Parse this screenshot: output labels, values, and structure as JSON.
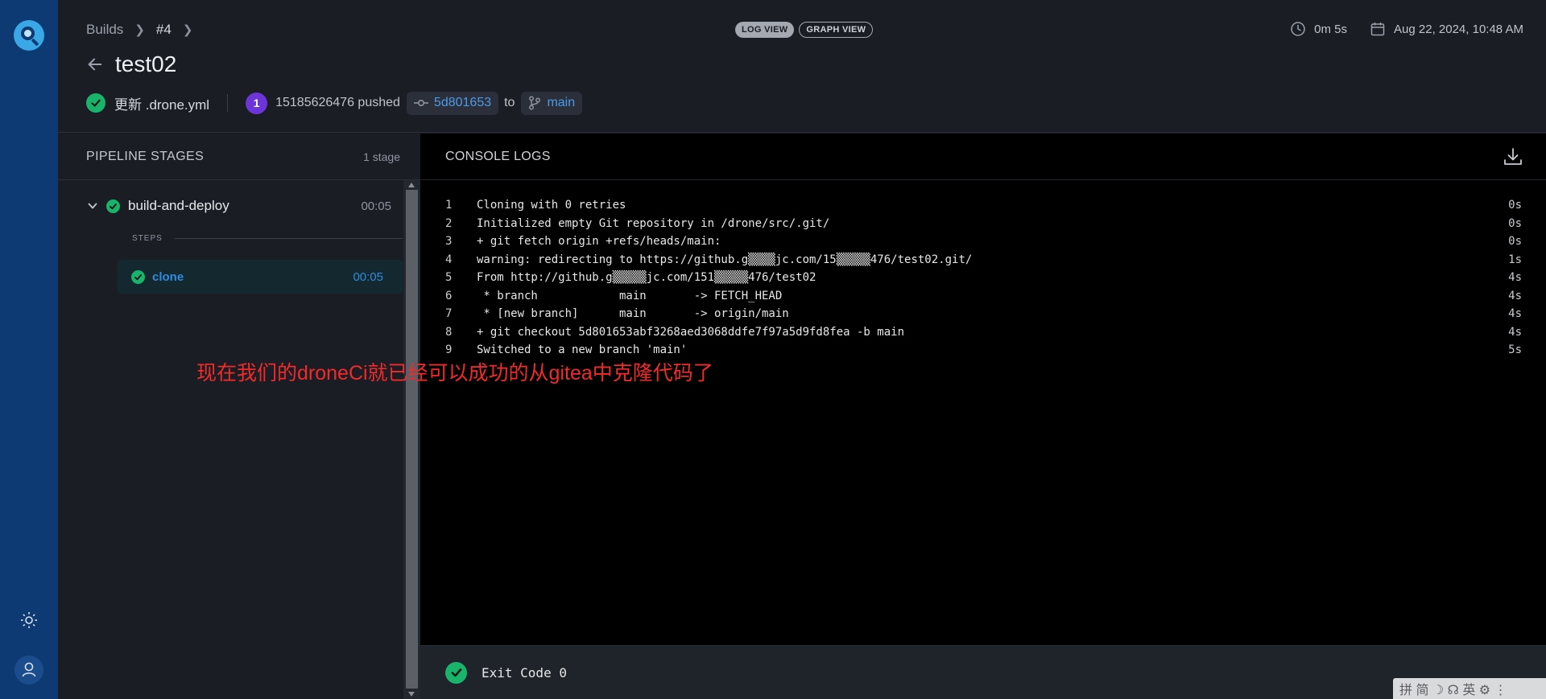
{
  "header": {
    "breadcrumbs": {
      "builds": "Builds",
      "build_number": "#4"
    },
    "title": "test02",
    "commit_message": "更新 .drone.yml",
    "author_badge": "1",
    "author_text": "15185626476 pushed",
    "commit_sha": "5d801653",
    "to_label": "to",
    "branch": "main",
    "view_toggle": {
      "log": "LOG VIEW",
      "graph": "GRAPH VIEW",
      "active": "log"
    },
    "duration": "0m 5s",
    "date": "Aug 22, 2024, 10:48 AM"
  },
  "stages": {
    "header": "PIPELINE STAGES",
    "count": "1 stage",
    "items": [
      {
        "name": "build-and-deploy",
        "time": "00:05",
        "status": "success",
        "steps_label": "STEPS",
        "steps": [
          {
            "name": "clone",
            "time": "00:05",
            "status": "success"
          }
        ]
      }
    ]
  },
  "annotation": "现在我们的droneCi就已经可以成功的从gitea中克隆代码了",
  "console": {
    "header": "CONSOLE LOGS",
    "lines": [
      {
        "num": "1",
        "text": "Cloning with 0 retries",
        "time": "0s"
      },
      {
        "num": "2",
        "text": "Initialized empty Git repository in /drone/src/.git/",
        "time": "0s"
      },
      {
        "num": "3",
        "text": "+ git fetch origin +refs/heads/main:",
        "time": "0s"
      },
      {
        "num": "4",
        "text": "warning: redirecting to https://github.g▒▒▒▒jc.com/15▒▒▒▒▒476/test02.git/",
        "time": "1s"
      },
      {
        "num": "5",
        "text": "From http://github.g▒▒▒▒▒jc.com/151▒▒▒▒▒476/test02",
        "time": "4s"
      },
      {
        "num": "6",
        "text": " * branch            main       -> FETCH_HEAD",
        "time": "4s"
      },
      {
        "num": "7",
        "text": " * [new branch]      main       -> origin/main",
        "time": "4s"
      },
      {
        "num": "8",
        "text": "+ git checkout 5d801653abf3268aed3068ddfe7f97a5d9fd8fea -b main",
        "time": "4s"
      },
      {
        "num": "9",
        "text": "Switched to a new branch 'main'",
        "time": "5s"
      }
    ],
    "exit_text": "Exit Code 0"
  },
  "ime_toolbar": "拼 简 ☽ ☊ 英 ⚙ ⋮"
}
